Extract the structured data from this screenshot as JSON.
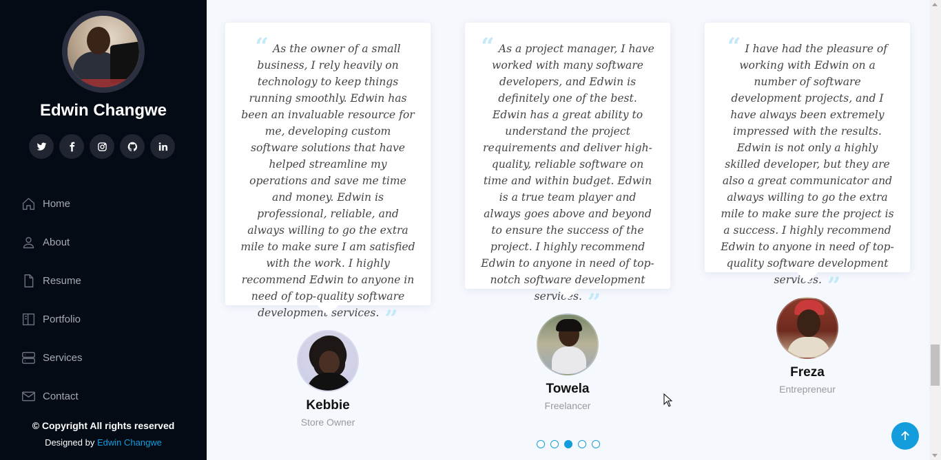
{
  "sidebar": {
    "profile_name": "Edwin Changwe",
    "socials": [
      {
        "icon": "twitter-icon"
      },
      {
        "icon": "facebook-icon"
      },
      {
        "icon": "instagram-icon"
      },
      {
        "icon": "github-icon"
      },
      {
        "icon": "linkedin-icon"
      }
    ],
    "nav": [
      {
        "label": "Home",
        "icon": "home-icon"
      },
      {
        "label": "About",
        "icon": "person-icon"
      },
      {
        "label": "Resume",
        "icon": "file-icon"
      },
      {
        "label": "Portfolio",
        "icon": "book-icon"
      },
      {
        "label": "Services",
        "icon": "server-icon"
      },
      {
        "label": "Contact",
        "icon": "envelope-icon"
      }
    ],
    "copyright": "© Copyright All rights reserved",
    "designed_by_prefix": "Designed by",
    "designed_by_name": "Edwin Changwe"
  },
  "testimonials": [
    {
      "text": "As the owner of a small business, I rely heavily on technology to keep things running smoothly. Edwin has been an invaluable resource for me, developing custom software solutions that have helped streamline my operations and save me time and money. Edwin is professional, reliable, and always willing to go the extra mile to make sure I am satisfied with the work. I highly recommend Edwin to anyone in need of top-quality software development services.",
      "name": "Kebbie",
      "role": "Store Owner"
    },
    {
      "text": "As a project manager, I have worked with many software developers, and Edwin is definitely one of the best. Edwin has a great ability to understand the project requirements and deliver high-quality, reliable software on time and within budget. Edwin is a true team player and always goes above and beyond to ensure the success of the project. I highly recommend Edwin to anyone in need of top-notch software development services.",
      "name": "Towela",
      "role": "Freelancer"
    },
    {
      "text": "I have had the pleasure of working with Edwin on a number of software development projects, and I have always been extremely impressed with the results. Edwin is not only a highly skilled developer, but they are also a great communicator and always willing to go the extra mile to make sure the project is a success. I highly recommend Edwin to anyone in need of top-quality software development services.",
      "name": "Freza",
      "role": "Entrepreneur"
    }
  ],
  "carousel": {
    "total": 5,
    "active": 3
  },
  "colors": {
    "accent": "#149ddd",
    "sidebar_bg": "#040b14",
    "page_bg": "#f5f8fd"
  }
}
